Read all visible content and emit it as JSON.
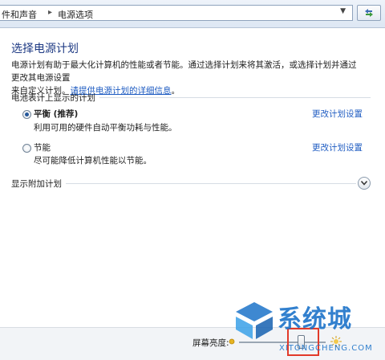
{
  "address_bar": {
    "crumbs": [
      "件和声音",
      "电源选项"
    ]
  },
  "content": {
    "title": "选择电源计划",
    "description_line1": "电源计划有助于最大化计算机的性能或者节能。通过选择计划来将其激活，或选择计划并通过更改其电源设置",
    "description_line2_prefix": "来自定义计划。",
    "description_link": "请提供电源计划的详细信息",
    "description_line2_suffix": "。",
    "section_label": "电池表计上显示的计划",
    "plans": [
      {
        "name": "平衡 (推荐)",
        "description": "利用可用的硬件自动平衡功耗与性能。",
        "change_link": "更改计划设置",
        "selected": true
      },
      {
        "name": "节能",
        "description": "尽可能降低计算机性能以节能。",
        "change_link": "更改计划设置",
        "selected": false
      }
    ],
    "extra_plans_label": "显示附加计划"
  },
  "bottom_bar": {
    "brightness_label": "屏幕亮度:",
    "brightness_level_percent": 72
  },
  "watermark": {
    "text": "系统城",
    "sub": "XITONGCHENG.COM"
  },
  "colors": {
    "title": "#1e3a84",
    "link": "#1f5cc2",
    "highlight": "#e23a2a",
    "watermark": "#1c73c9"
  }
}
